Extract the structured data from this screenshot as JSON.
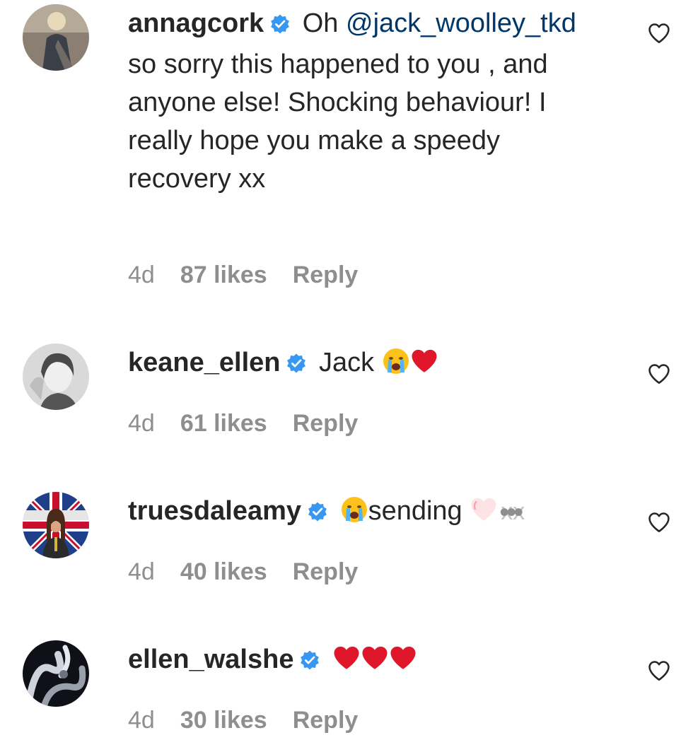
{
  "comments": [
    {
      "username": "annagcork",
      "verified": true,
      "text_pre": "Oh",
      "mention": "@jack_woolley_tkd",
      "text_post": "so sorry this happened to you , and anyone else! Shocking behaviour! I really hope you make a speedy recovery xx",
      "time": "4d",
      "likes": "87 likes",
      "reply": "Reply"
    },
    {
      "username": "keane_ellen",
      "verified": true,
      "text": "Jack",
      "emojis": [
        "crying-face-emoji",
        "red-heart-emoji"
      ],
      "time": "4d",
      "likes": "61 likes",
      "reply": "Reply"
    },
    {
      "username": "truesdaleamy",
      "verified": true,
      "text": "sending",
      "tail_text": "xx",
      "emojis": [
        "crying-face-emoji",
        "light-heart-emoji"
      ],
      "time": "4d",
      "likes": "40 likes",
      "reply": "Reply"
    },
    {
      "username": "ellen_walshe",
      "verified": true,
      "emojis": [
        "red-heart-emoji",
        "red-heart-emoji",
        "red-heart-emoji"
      ],
      "time": "4d",
      "likes": "30 likes",
      "reply": "Reply"
    }
  ],
  "colors": {
    "text": "#262626",
    "meta": "#8e8e8e",
    "mention": "#00376b",
    "verified": "#3897f0",
    "heart_red": "#e0162b"
  }
}
